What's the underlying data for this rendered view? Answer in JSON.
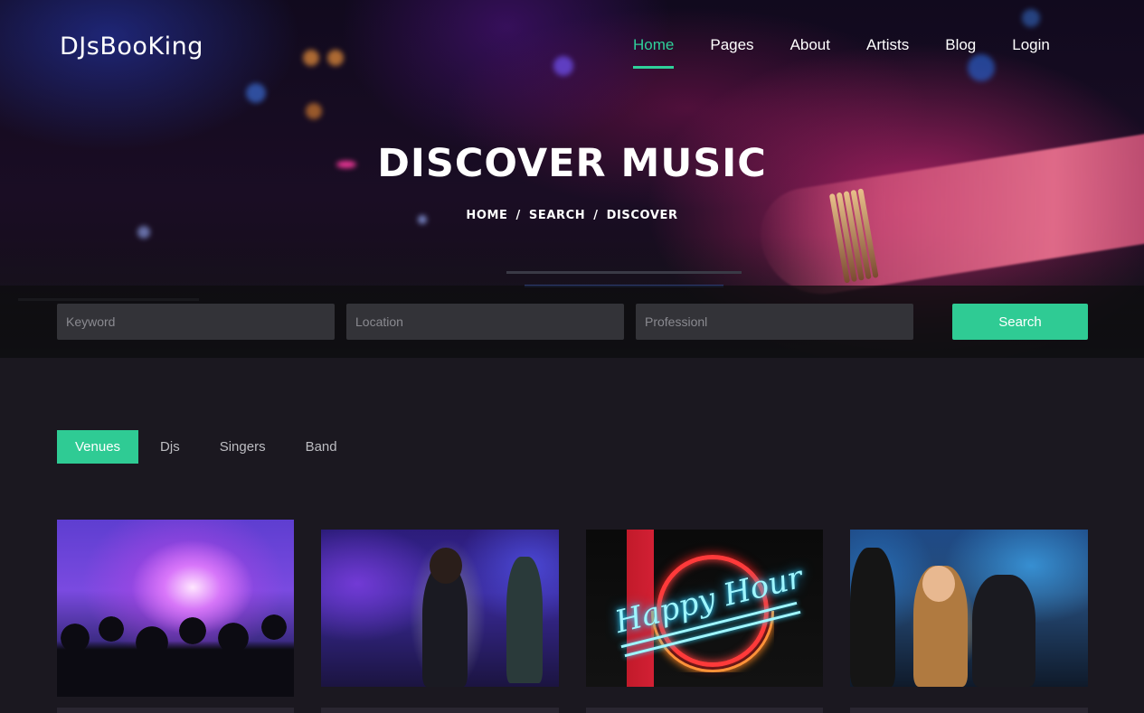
{
  "brand": "DJsBooKing",
  "nav": {
    "items": [
      "Home",
      "Pages",
      "About",
      "Artists",
      "Blog",
      "Login"
    ],
    "active": "Home"
  },
  "hero": {
    "title": "DISCOVER MUSIC",
    "breadcrumb": [
      "HOME",
      "SEARCH",
      "DISCOVER"
    ],
    "separator": "/"
  },
  "search": {
    "keyword_placeholder": "Keyword",
    "location_placeholder": "Location",
    "profession_placeholder": "Professionl",
    "button_label": "Search"
  },
  "tabs": {
    "items": [
      "Venues",
      "Djs",
      "Singers",
      "Band"
    ],
    "active": "Venues"
  },
  "colors": {
    "accent": "#2fcb94",
    "background": "#1b1820",
    "field_bg": "#333338"
  },
  "cards": [
    {
      "image": "concert-crowd"
    },
    {
      "image": "club-dancer"
    },
    {
      "image": "neon-sign",
      "sign_text": "Happy Hour"
    },
    {
      "image": "club-party"
    }
  ]
}
